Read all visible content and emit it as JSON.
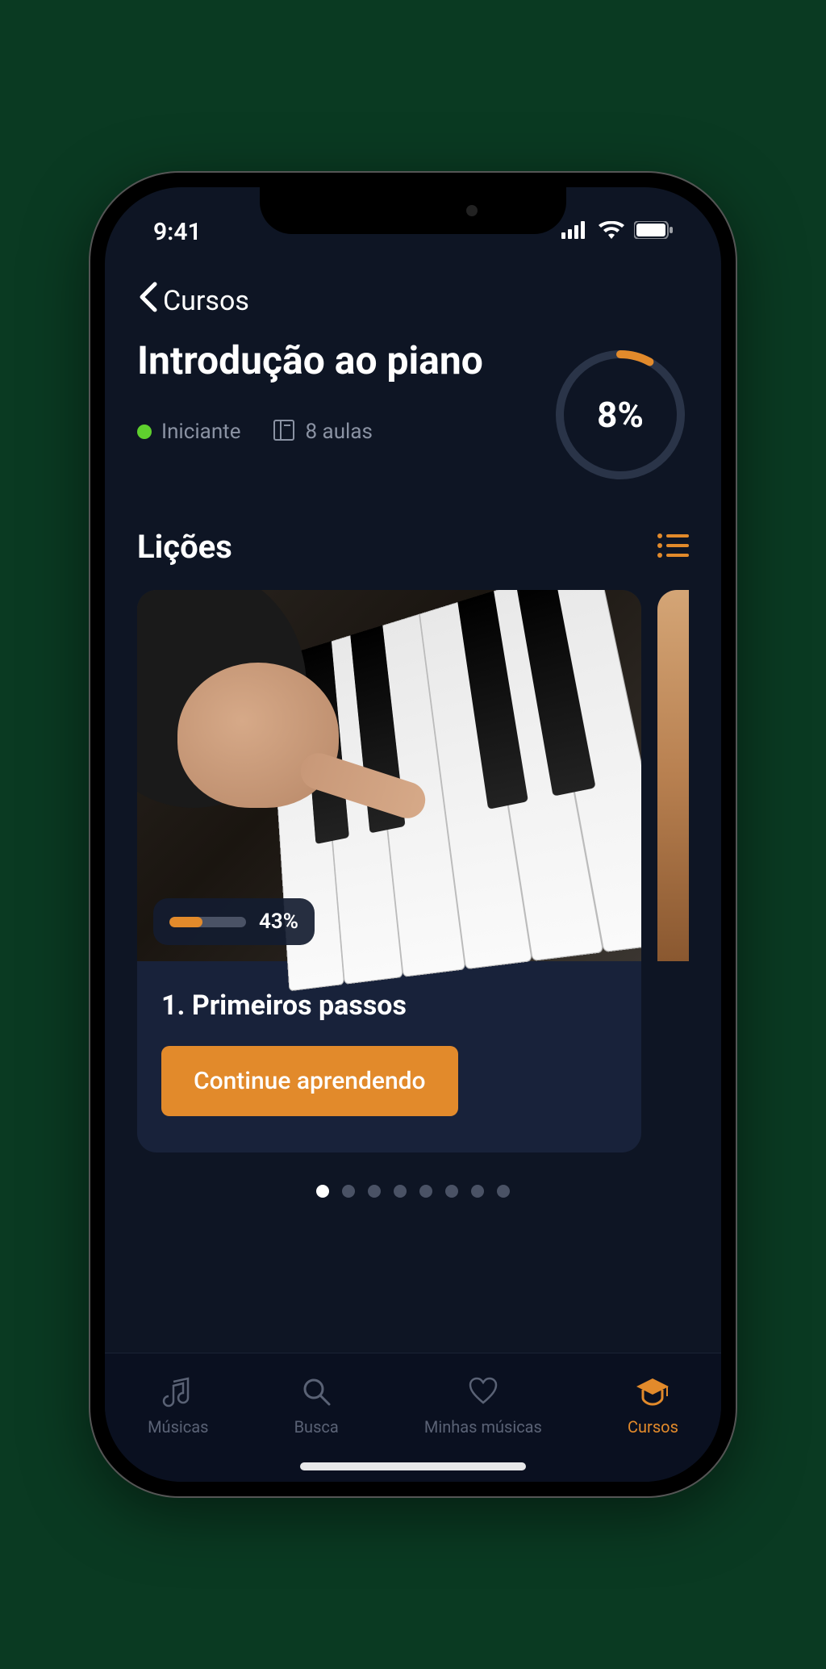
{
  "status": {
    "time": "9:41"
  },
  "nav": {
    "back_label": "Cursos"
  },
  "course": {
    "title": "Introdução ao piano",
    "level": "Iniciante",
    "lessons_count": "8 aulas",
    "progress_pct": "8%",
    "progress_value": 8
  },
  "lessons_section": {
    "title": "Lições"
  },
  "lesson_card": {
    "progress_pct": "43%",
    "progress_value": 43,
    "title": "1. Primeiros passos",
    "cta": "Continue aprendendo"
  },
  "pager": {
    "total": 8,
    "active_index": 0
  },
  "tabs": [
    {
      "label": "Músicas",
      "icon": "music",
      "active": false
    },
    {
      "label": "Busca",
      "icon": "search",
      "active": false
    },
    {
      "label": "Minhas músicas",
      "icon": "heart",
      "active": false
    },
    {
      "label": "Cursos",
      "icon": "grad-cap",
      "active": true
    }
  ]
}
